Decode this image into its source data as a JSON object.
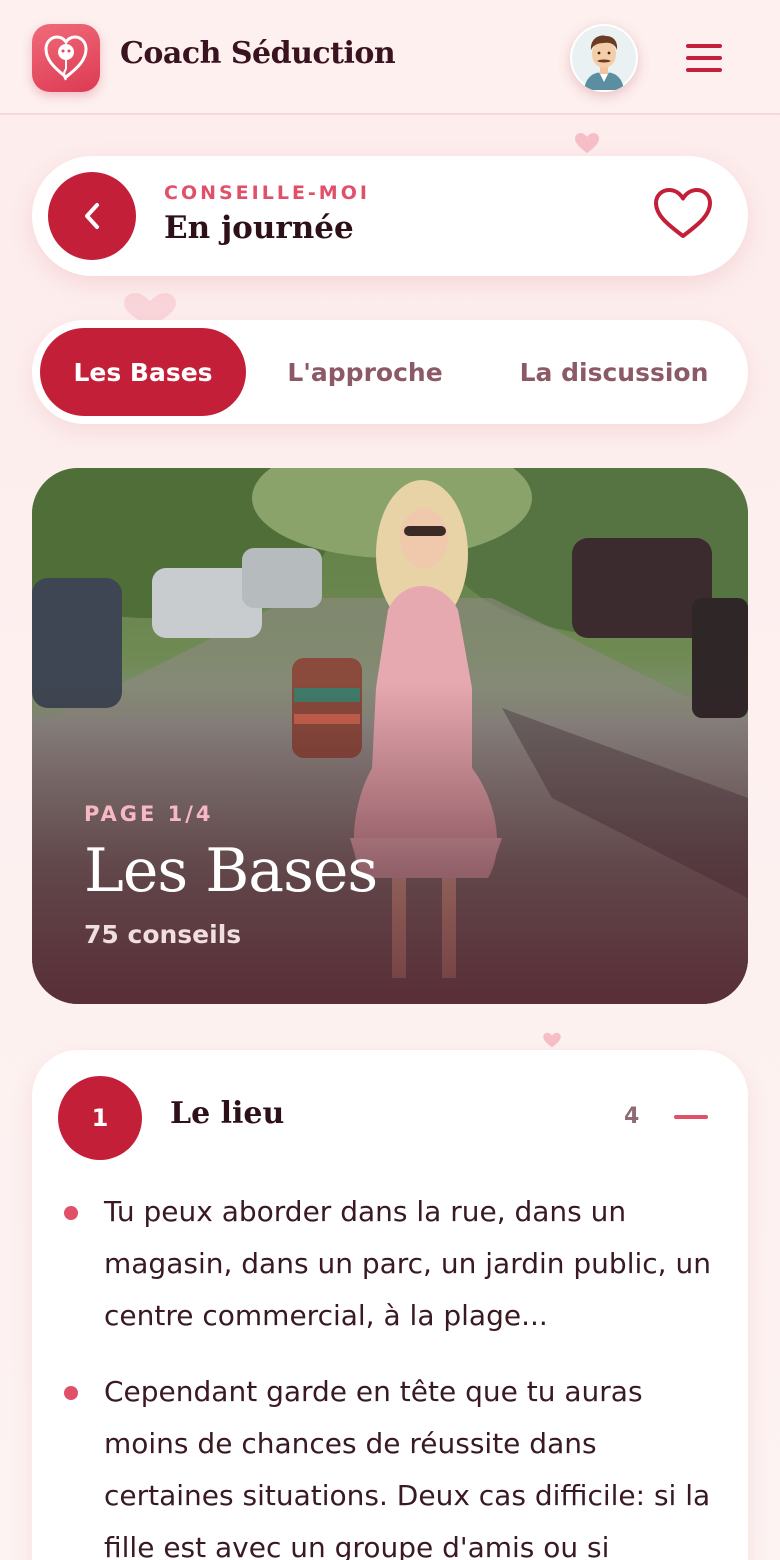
{
  "header": {
    "app_name": "Coach Séduction",
    "logo_icon": "heart-brain-icon",
    "avatar_icon": "user-avatar-icon",
    "menu_icon": "hamburger-menu-icon"
  },
  "nav": {
    "kicker": "CONSEILLE-MOI",
    "title": "En journée",
    "back_icon": "chevron-left-icon",
    "favorite_icon": "heart-outline-icon"
  },
  "tabs": [
    {
      "label": "Les Bases",
      "active": true
    },
    {
      "label": "L'approche",
      "active": false
    },
    {
      "label": "La discussion",
      "active": false
    }
  ],
  "hero": {
    "page_indicator": "PAGE 1/4",
    "title": "Les Bases",
    "count_label": "75 conseils"
  },
  "section": {
    "number": "1",
    "title": "Le lieu",
    "count": "4",
    "collapse_icon": "minus-icon",
    "bullets": [
      "Tu peux aborder dans la rue, dans un magasin, dans un parc, un jardin public, un centre commercial, à la plage...",
      "Cependant garde en tête que tu auras moins de chances de réussite dans certaines situations. Deux cas difficile: si la fille est avec un groupe d'amis ou si"
    ]
  },
  "colors": {
    "brand": "#c41f38",
    "accent": "#e05169",
    "background": "#fdecec"
  }
}
